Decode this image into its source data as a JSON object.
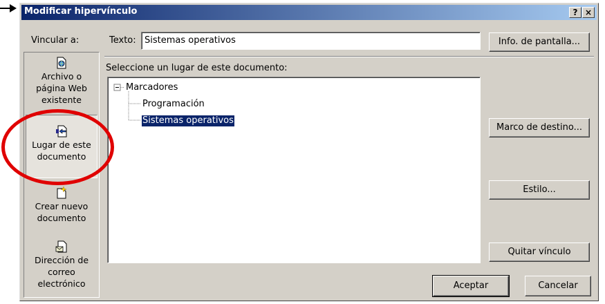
{
  "window": {
    "title": "Modificar hipervínculo",
    "help_label": "?",
    "close_label": "×"
  },
  "link_to": {
    "label": "Vincular a:",
    "items": [
      {
        "label_line1": "Archivo o",
        "label_line2": "página Web",
        "label_line3": "existente",
        "icon": "web-file-icon"
      },
      {
        "label_line1": "Lugar de este",
        "label_line2": "documento",
        "icon": "place-in-document-icon",
        "selected": true
      },
      {
        "label_line1": "Crear nuevo",
        "label_line2": "documento",
        "icon": "new-document-icon"
      },
      {
        "label_line1": "Dirección de",
        "label_line2": "correo",
        "label_line3": "electrónico",
        "icon": "email-address-icon"
      }
    ]
  },
  "text_field": {
    "label": "Texto:",
    "value": "Sistemas operativos"
  },
  "buttons": {
    "screentip": "Info. de pantalla...",
    "target_frame": "Marco de destino...",
    "style": "Estilo...",
    "remove_link": "Quitar vínculo",
    "ok": "Aceptar",
    "cancel": "Cancelar"
  },
  "place": {
    "label": "Seleccione un lugar de este documento:",
    "tree": {
      "root": {
        "label": "Marcadores",
        "expander": "⊟"
      },
      "children": [
        {
          "label": "Programación",
          "selected": false
        },
        {
          "label": "Sistemas operativos",
          "selected": true
        }
      ]
    }
  },
  "colors": {
    "title_bar_start": "#0a246a",
    "title_bar_end": "#a6caf0",
    "highlight": "#0a246a",
    "annotation_circle": "#e00000",
    "dialog_face": "#d4d0c8"
  }
}
